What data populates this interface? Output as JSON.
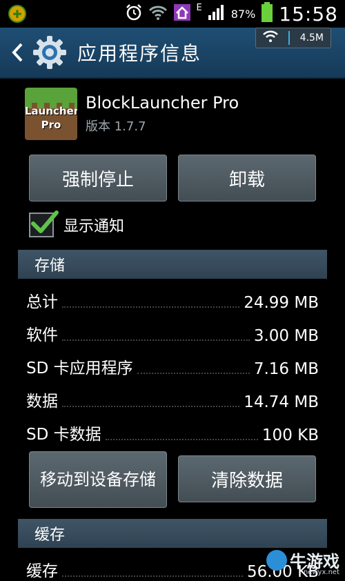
{
  "status_bar": {
    "time": "15:58",
    "battery_percent": "87%",
    "network_type": "E",
    "icons": [
      "app-notification-icon",
      "alarm-icon",
      "wifi-icon",
      "home-icon",
      "signal-icon",
      "battery-icon"
    ]
  },
  "net_overlay": {
    "speed": "4.5M",
    "icon": "wifi-icon"
  },
  "title_bar": {
    "title": "应用程序信息",
    "icons": [
      "back-icon",
      "settings-gear-icon"
    ]
  },
  "app": {
    "name": "BlockLauncher Pro",
    "version": "版本 1.7.7",
    "icon_text_line1": "Launcher",
    "icon_text_line2": "Pro"
  },
  "buttons": {
    "force_stop": "强制停止",
    "uninstall": "卸载",
    "move_to_device": "移动到设备存储",
    "clear_data": "清除数据"
  },
  "notifications": {
    "label": "显示通知",
    "checked": true
  },
  "storage": {
    "header": "存储",
    "rows": [
      {
        "label": "总计",
        "value": "24.99 MB"
      },
      {
        "label": "软件",
        "value": "3.00 MB"
      },
      {
        "label": "SD 卡应用程序",
        "value": "7.16 MB"
      },
      {
        "label": "数据",
        "value": "14.74 MB"
      },
      {
        "label": "SD 卡数据",
        "value": "100 KB"
      }
    ]
  },
  "cache": {
    "header": "缓存",
    "rows": [
      {
        "label": "缓存",
        "value": "56.00 KB"
      }
    ]
  },
  "watermark": {
    "text": "牛游戏",
    "url": "newyx.net"
  },
  "colors": {
    "title_bar": "#1f4e74",
    "section_header": "#3f5566",
    "button": "#4f5a61",
    "checkmark": "#5fc24a",
    "background": "#000000"
  }
}
